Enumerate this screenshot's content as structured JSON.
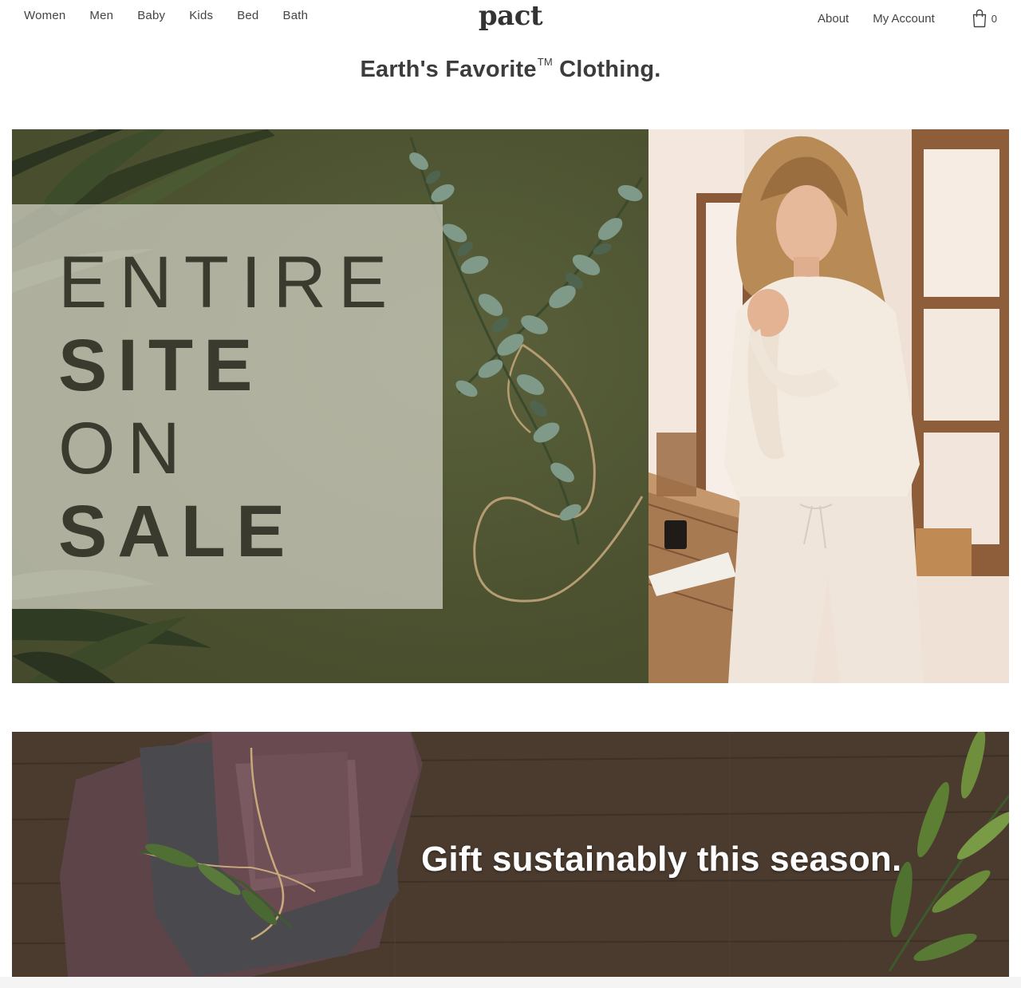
{
  "header": {
    "nav_left": [
      {
        "label": "Women"
      },
      {
        "label": "Men"
      },
      {
        "label": "Baby"
      },
      {
        "label": "Kids"
      },
      {
        "label": "Bed"
      },
      {
        "label": "Bath"
      }
    ],
    "logo": "pact",
    "nav_right": {
      "about": "About",
      "account": "My Account",
      "cart_count": "0",
      "cart_icon": "shopping-bag-icon"
    }
  },
  "tagline": {
    "text": "Earth's Favorite",
    "trademark": "TM",
    "suffix": " Clothing."
  },
  "hero": {
    "line1": "ENTIRE",
    "line2": "SITE",
    "line3": "ON",
    "line4": "SALE",
    "colors": {
      "olive": "#4e5432",
      "overlay": "#cacbbc",
      "text": "#3a3b2e"
    }
  },
  "gift_banner": {
    "text": "Gift sustainably this season.",
    "colors": {
      "wood": "#4a3b2e",
      "towel": "#5c4448"
    }
  }
}
